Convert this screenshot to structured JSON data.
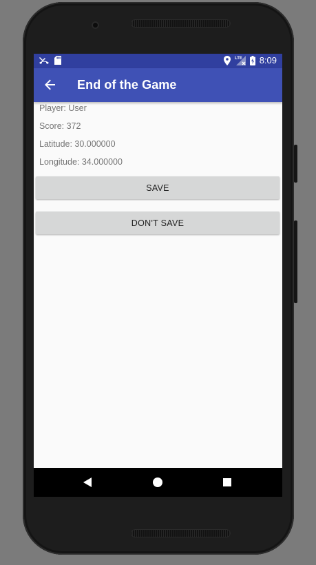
{
  "status_bar": {
    "time": "8:09",
    "left_icons": [
      "missed-call-icon",
      "sd-card-icon"
    ],
    "right_icons": [
      "location-icon",
      "lte-signal-icon",
      "battery-charging-icon"
    ],
    "signal_label": "LTE"
  },
  "app_bar": {
    "title": "End of the Game",
    "back_icon": "arrow-back-icon"
  },
  "details": {
    "player": "Player: User",
    "score": "Score: 372",
    "latitude": "Latitude: 30.000000",
    "longitude": "Longitude: 34.000000"
  },
  "actions": {
    "save_label": "SAVE",
    "dont_save_label": "DON'T SAVE"
  },
  "nav_bar": {
    "icons": [
      "back-triangle-icon",
      "home-circle-icon",
      "recents-square-icon"
    ]
  },
  "colors": {
    "status_bar": "#303f9f",
    "app_bar": "#3f51b5",
    "button": "#d6d7d7",
    "text_secondary": "#757575"
  }
}
